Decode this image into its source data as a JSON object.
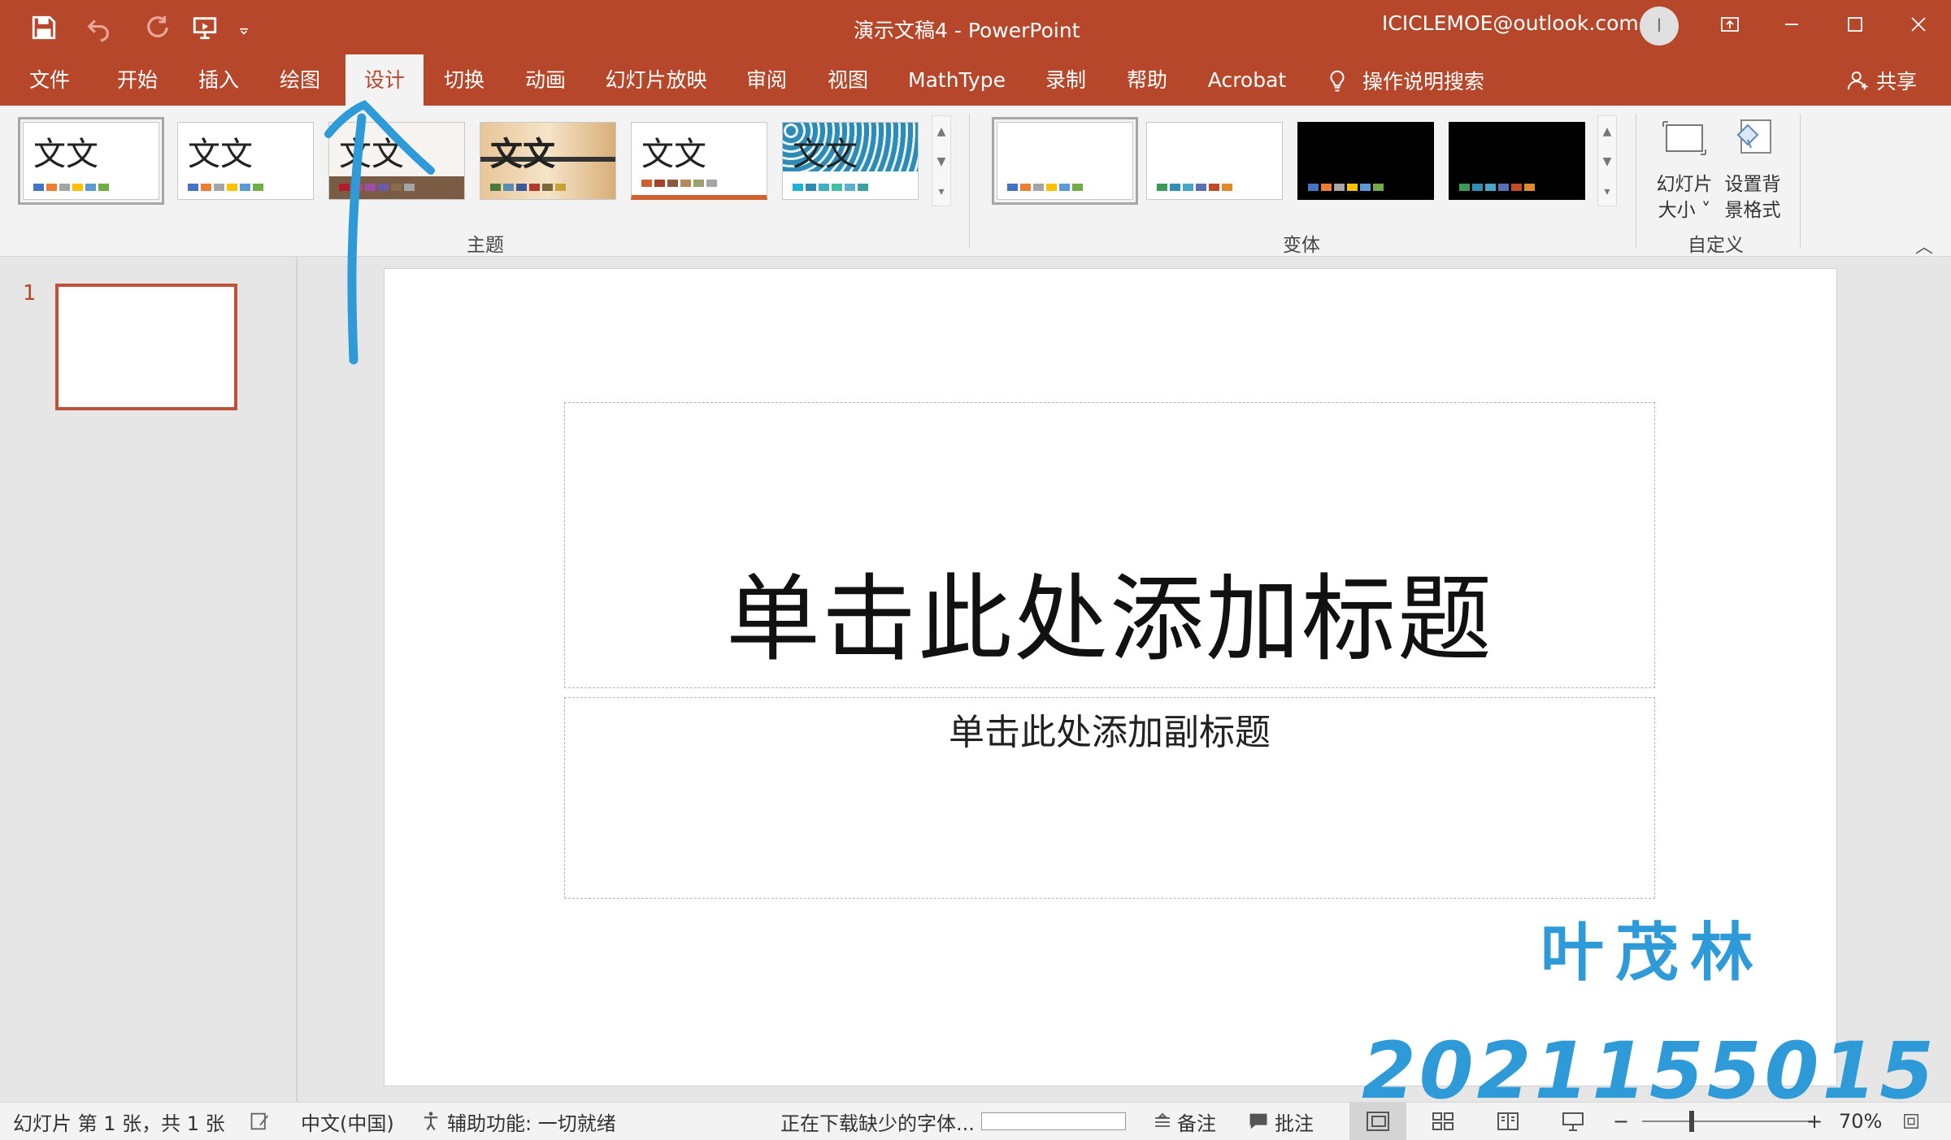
{
  "titlebar": {
    "document_title": "演示文稿4  -  PowerPoint",
    "account_email": "ICICLEMOE@outlook.com",
    "avatar_initial": "I"
  },
  "tabs": [
    "文件",
    "开始",
    "插入",
    "绘图",
    "设计",
    "切换",
    "动画",
    "幻灯片放映",
    "审阅",
    "视图",
    "MathType",
    "录制",
    "帮助",
    "Acrobat"
  ],
  "active_tab": "设计",
  "tell_me": "操作说明搜索",
  "share": "共享",
  "ribbon": {
    "themes_label": "主题",
    "variants_label": "变体",
    "customize_label": "自定义",
    "theme_sample_text": "文文",
    "slide_size_label_1": "幻灯片",
    "slide_size_label_2": "大小 ˅",
    "format_bg_label_1": "设置背",
    "format_bg_label_2": "景格式"
  },
  "slides_pane": {
    "slide_number": "1"
  },
  "slide": {
    "title_placeholder": "单击此处添加标题",
    "subtitle_placeholder": "单击此处添加副标题"
  },
  "annotations": {
    "name": "叶茂林",
    "student_id": "2021155015",
    "color": "#2f9ad8"
  },
  "statusbar": {
    "slide_info": "幻灯片 第 1 张，共 1 张",
    "language": "中文(中国)",
    "accessibility": "辅助功能: 一切就绪",
    "downloading": "正在下载缺少的字体...",
    "notes": "备注",
    "comments": "批注",
    "zoom_minus": "−",
    "zoom_plus": "+",
    "zoom": "70%"
  },
  "colors": {
    "accent": "#b7472a",
    "ribbon_bg": "#f3f3f3",
    "annotation": "#2f9ad8"
  }
}
